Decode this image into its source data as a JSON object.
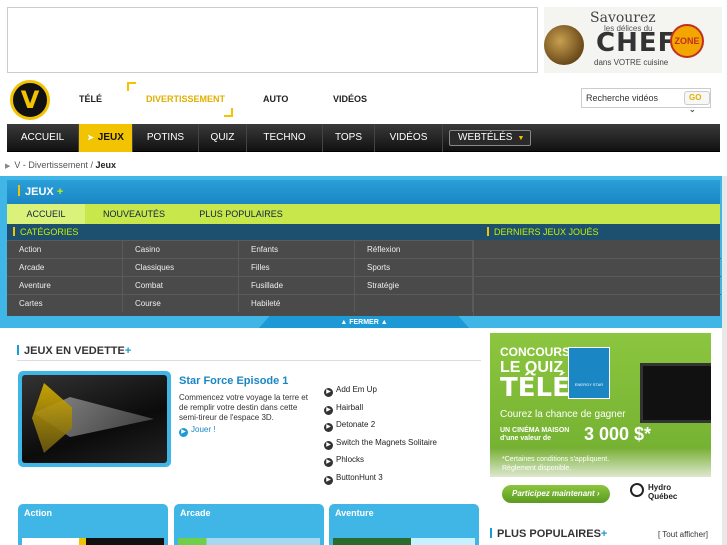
{
  "ad": {
    "chef_line1": "Savourez",
    "chef_line2": "les délices du",
    "chef_line3": "CHEF",
    "chef_line4": "dans VOTRE cuisine",
    "zone_badge": "ZONE"
  },
  "logo": {
    "letter": "V"
  },
  "top_nav": {
    "items": [
      {
        "label": "TÉLÉ",
        "active": false
      },
      {
        "label": "DIVERTISSEMENT",
        "active": true
      },
      {
        "label": "AUTO",
        "active": false
      },
      {
        "label": "VIDÉOS",
        "active": false
      }
    ]
  },
  "search": {
    "value": "Recherche vidéos",
    "go_label": "GO"
  },
  "main_nav": {
    "items": [
      {
        "label": "ACCUEIL"
      },
      {
        "label": "JEUX",
        "active": true
      },
      {
        "label": "POTINS"
      },
      {
        "label": "QUIZ"
      },
      {
        "label": "TECHNO"
      },
      {
        "label": "TOPS"
      },
      {
        "label": "VIDÉOS"
      }
    ],
    "webteles": "WEBTÉLÉS"
  },
  "breadcrumb": {
    "parent": "V - Divertissement",
    "separator": "/",
    "current": "Jeux"
  },
  "games_panel": {
    "title": "JEUX",
    "title_plus": "+",
    "subtabs": [
      "ACCUEIL",
      "NOUVEAUTÉS",
      "PLUS POPULAIRES"
    ],
    "categories_label": "CATÉGORIES",
    "recent_label": "DERNIERS JEUX JOUÉS",
    "categories": [
      [
        "Action",
        "Casino",
        "Enfants",
        "Réflexion"
      ],
      [
        "Arcade",
        "Classiques",
        "Filles",
        "Sports"
      ],
      [
        "Aventure",
        "Combat",
        "Fusillade",
        "Stratégie"
      ],
      [
        "Cartes",
        "Course",
        "Habileté",
        ""
      ]
    ],
    "close_label": "▲ FERMER ▲"
  },
  "featured": {
    "section_title": "JEUX EN VEDETTE",
    "section_plus": "+",
    "game_title": "Star Force Episode 1",
    "game_desc": "Commencez votre voyage la terre et de remplir votre destin dans cette semi-tireur de l'espace 3D.",
    "play_label": "Jouer !",
    "other_games": [
      "Add Em Up",
      "Hairball",
      "Detonate 2",
      "Switch the Magnets Solitaire",
      "Phlocks",
      "ButtonHunt 3"
    ]
  },
  "category_cards": [
    "Action",
    "Arcade",
    "Aventure"
  ],
  "promo": {
    "concours": "CONCOURS",
    "quiz": "LE QUIZ",
    "tele": "TÉLÉ",
    "energy": "ENERGY STAR",
    "chance": "Courez la chance de gagner",
    "prize_label_1": "UN CINÉMA MAISON",
    "prize_label_2": "d'une valeur de",
    "prize_value": "3 000 $*",
    "cond_1": "*Certaines conditions s'appliquent.",
    "cond_2": "Règlement disponible.",
    "button": "Participez maintenant  ›",
    "brand_1": "Hydro",
    "brand_2": "Québec"
  },
  "popular": {
    "title": "PLUS POPULAIRES",
    "title_plus": "+",
    "show_all": "[ Tout afficher]"
  },
  "colors": {
    "accent_yellow": "#f2c300",
    "accent_blue": "#1a9ad6",
    "band_blue": "#3fb6e6",
    "lime": "#c7e74a",
    "promo_green": "#8cc63f"
  }
}
